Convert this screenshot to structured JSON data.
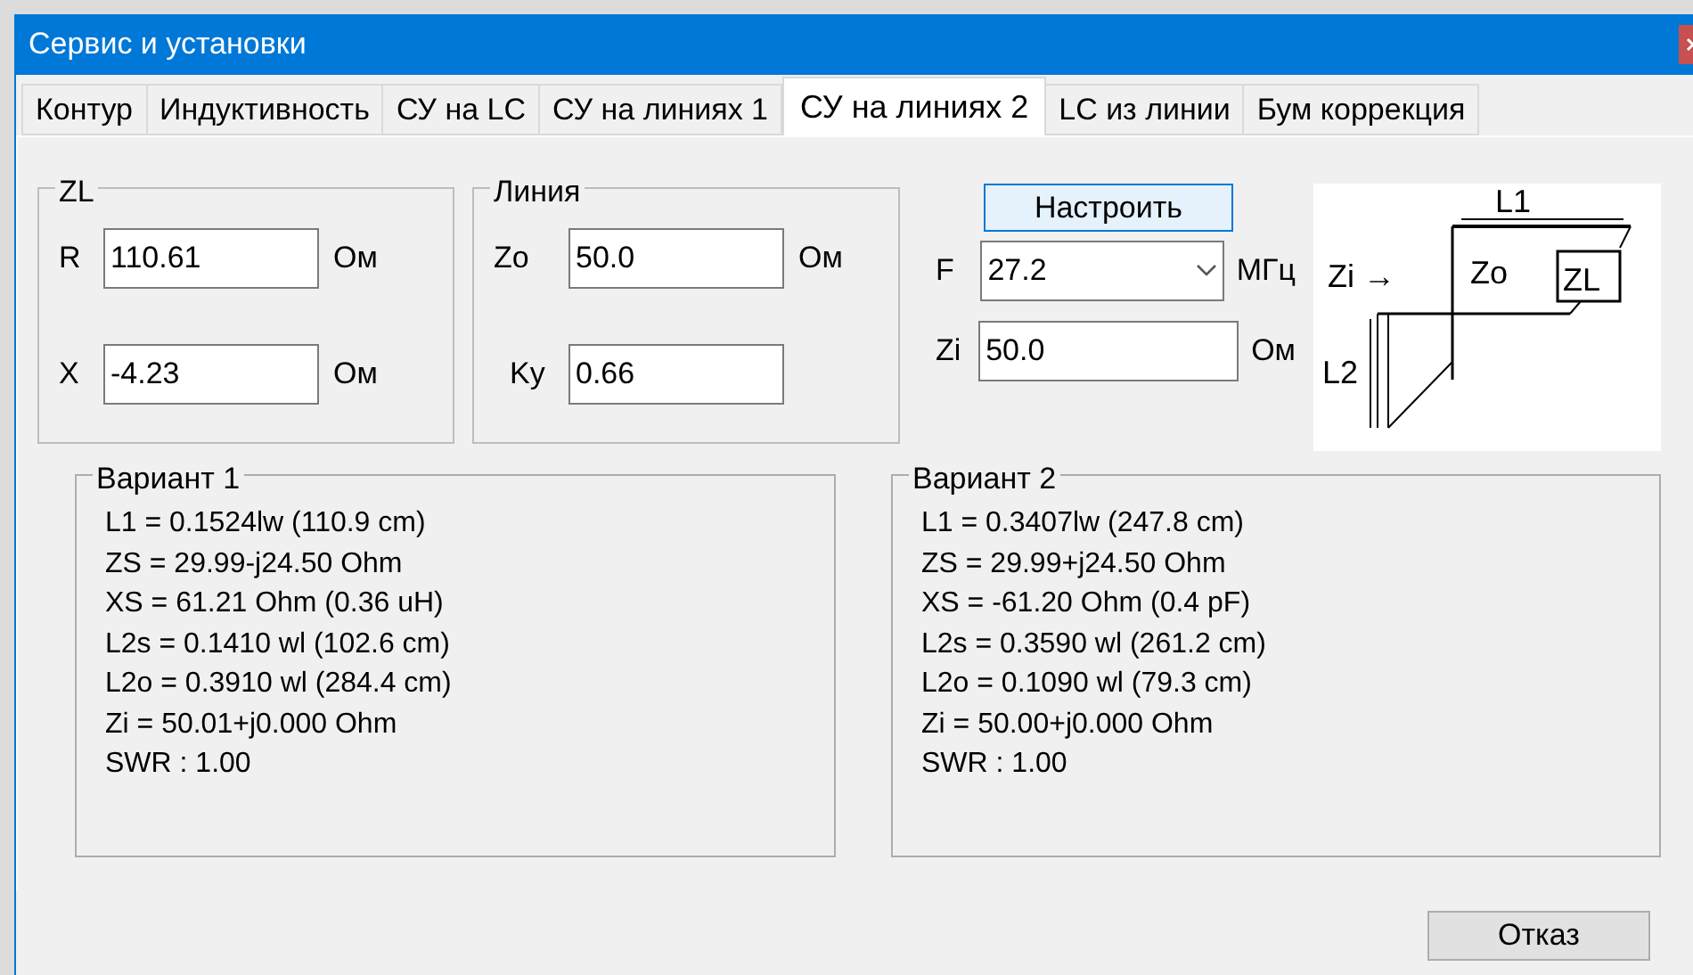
{
  "window": {
    "title": "Сервис и установки"
  },
  "tabs": [
    {
      "label": "Контур",
      "selected": false
    },
    {
      "label": "Индуктивность",
      "selected": false
    },
    {
      "label": "СУ на LC",
      "selected": false
    },
    {
      "label": "СУ на линиях 1",
      "selected": false
    },
    {
      "label": "СУ на линиях 2",
      "selected": true
    },
    {
      "label": "LC из линии",
      "selected": false
    },
    {
      "label": "Бум коррекция",
      "selected": false
    }
  ],
  "zl_group": {
    "title": "ZL",
    "rows": [
      {
        "label": "R",
        "value": "110.61",
        "unit": "Ом"
      },
      {
        "label": "X",
        "value": "-4.23",
        "unit": "Ом"
      }
    ]
  },
  "line_group": {
    "title": "Линия",
    "rows": [
      {
        "label": "Zo",
        "value": "50.0",
        "unit": "Ом"
      },
      {
        "label": "Ky",
        "value": "0.66"
      }
    ]
  },
  "tune_button": "Настроить",
  "frequency": {
    "label": "F",
    "value": "27.2",
    "unit": "МГц"
  },
  "zi": {
    "label": "Zi",
    "value": "50.0",
    "unit": "Ом"
  },
  "diagram": {
    "l1": "L1",
    "zi": "Zi →",
    "zo": "Zo",
    "zl": "ZL",
    "l2": "L2"
  },
  "variants": [
    {
      "title": "Вариант 1",
      "lines": [
        "L1 = 0.1524lw (110.9 cm)",
        "ZS = 29.99-j24.50 Ohm",
        "XS = 61.21 Ohm (0.36 uH)",
        "L2s = 0.1410 wl (102.6 cm)",
        "L2o = 0.3910 wl (284.4 cm)",
        "Zi = 50.01+j0.000 Ohm",
        "SWR : 1.00"
      ]
    },
    {
      "title": "Вариант 2",
      "lines": [
        "L1 = 0.3407lw (247.8 cm)",
        "ZS = 29.99+j24.50 Ohm",
        "XS = -61.20 Ohm (0.4 pF)",
        "L2s = 0.3590 wl (261.2 cm)",
        "L2o = 0.1090 wl (79.3 cm)",
        "Zi = 50.00+j0.000 Ohm",
        "SWR : 1.00"
      ]
    }
  ],
  "cancel_button": "Отказ"
}
